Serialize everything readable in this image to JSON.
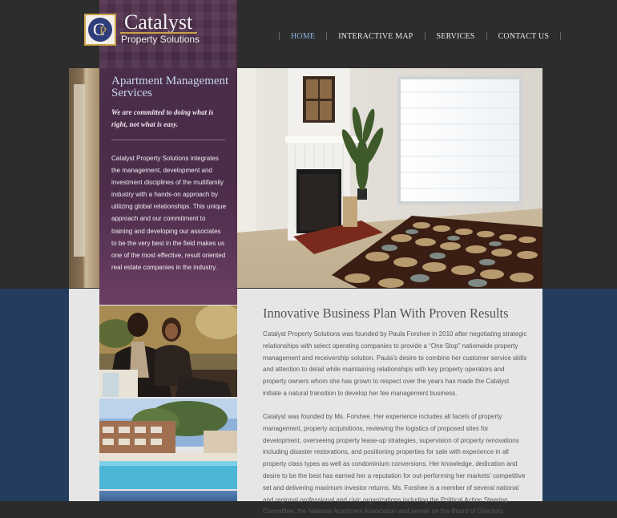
{
  "brand": {
    "name": "Catalyst",
    "tagline": "Property Solutions",
    "mark_letters": "CP"
  },
  "nav": {
    "items": [
      "HOME",
      "INTERACTIVE MAP",
      "SERVICES",
      "CONTACT US"
    ],
    "active": "HOME"
  },
  "sidebar": {
    "title": "Apartment Management Services",
    "tagline": "We are committed to doing what is right, not what is easy.",
    "body": "Catalyst Property Solutions integrates the management, development and investment disciplines of the multifamily industry with a hands-on approach by utilizing global relationships. This unique approach and our commitment to training and developing our associates to be the very best in the field makes us one of the most effective, result oriented real estate companies in the industry."
  },
  "main": {
    "title": "Innovative Business Plan With Proven Results",
    "paragraphs": [
      "Catalyst Property Solutions was founded by Paula Forshee in 2010 after negotiating strategic relationships with select operating companies to provide a “One Stop” nationwide property management and receivership solution. Paula’s desire to combine her customer service skills and attention to detail while maintaining relationships with key property operators and property owners whom she has grown to respect over the years has made the Catalyst initiate a natural transition to develop her fee management business.",
      "Catalyst was founded by Ms. Forshee. Her experience includes all facets of property management, property acquisitions, reviewing the logistics of proposed sites for development, overseeing property lease-up strategies, supervision of property renovations including disaster restorations, and positioning properties for sale with experience in all property class types as well as condominium conversions. Her knowledge, dedication and desire to be the best has earned her a reputation for out-performing her markets’ competitive set and delivering maximum investor returns. Ms. Forshee is a member of several national and regional professional and civic organizations including the Political Action Steering Committee, the National Apartment Association and serves on the Board of Directors"
    ]
  },
  "colors": {
    "purple": "#4b2c49",
    "navy": "#243d5e",
    "nav_active": "#8fb4e0",
    "gold": "#c9a24a"
  }
}
